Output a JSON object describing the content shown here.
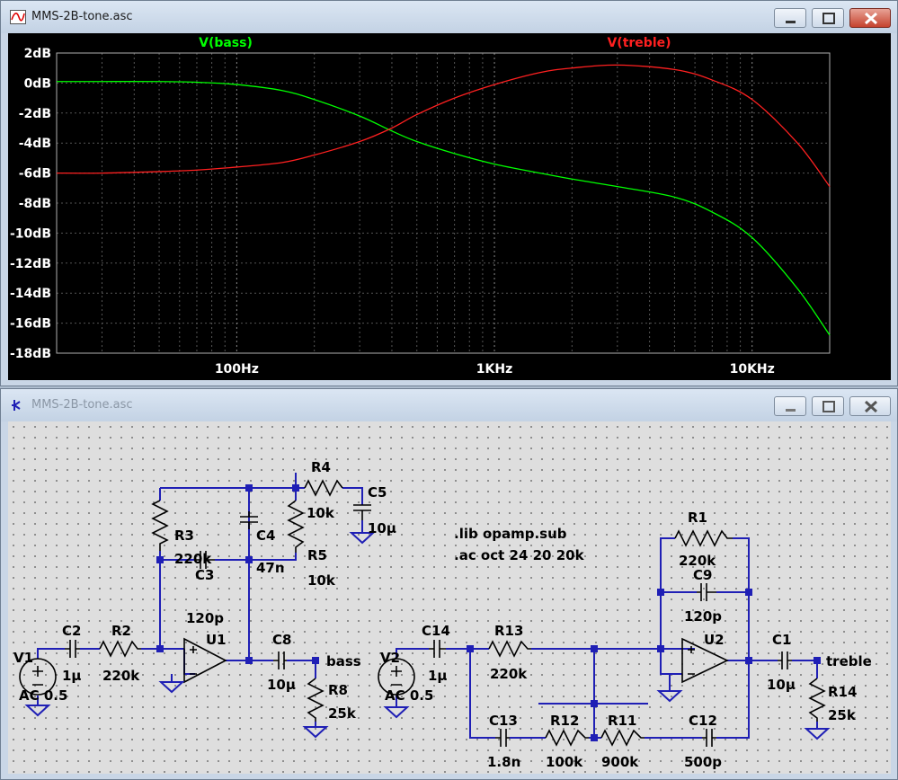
{
  "waveform_window": {
    "title": "MMS-2B-tone.asc",
    "traces": [
      {
        "name": "V(bass)",
        "color": "#00ff00"
      },
      {
        "name": "V(treble)",
        "color": "#ff2020"
      }
    ],
    "y_ticks": [
      "2dB",
      "0dB",
      "-2dB",
      "-4dB",
      "-6dB",
      "-8dB",
      "-10dB",
      "-12dB",
      "-14dB",
      "-16dB",
      "-18dB"
    ],
    "x_ticks": [
      "100Hz",
      "1KHz",
      "10KHz"
    ]
  },
  "chart_data": {
    "type": "line",
    "xscale": "log",
    "xlim": [
      20,
      20000
    ],
    "ylim": [
      -18,
      2
    ],
    "ylabel": "",
    "xlabel": "",
    "grid": true,
    "x": [
      20,
      30,
      50,
      70,
      100,
      150,
      200,
      300,
      400,
      500,
      700,
      1000,
      1500,
      2000,
      3000,
      5000,
      7000,
      10000,
      15000,
      20000
    ],
    "series": [
      {
        "name": "V(bass)",
        "values": [
          0.1,
          0.1,
          0.1,
          0.05,
          -0.1,
          -0.5,
          -1.1,
          -2.2,
          -3.2,
          -3.9,
          -4.7,
          -5.4,
          -6.0,
          -6.4,
          -6.9,
          -7.6,
          -8.6,
          -10.3,
          -13.7,
          -16.8
        ]
      },
      {
        "name": "V(treble)",
        "values": [
          -6.0,
          -6.0,
          -5.9,
          -5.8,
          -5.6,
          -5.3,
          -4.8,
          -3.9,
          -3.0,
          -2.1,
          -1.0,
          -0.1,
          0.7,
          1.0,
          1.2,
          0.9,
          0.2,
          -1.1,
          -4.0,
          -6.9
        ]
      }
    ]
  },
  "schematic_window": {
    "title": "MMS-2B-tone.asc",
    "directives": [
      ".lib opamp.sub",
      ".ac oct 24 20 20k"
    ],
    "labels": {
      "V1": "V1",
      "V1val": "AC 0.5",
      "C2": "C2",
      "C2val": "1µ",
      "R2": "R2",
      "R2val": "220k",
      "R3": "R3",
      "R3val": "220k",
      "C3": "C3",
      "C3val": "120p",
      "C4": "C4",
      "C4val": "47n",
      "R4": "R4",
      "R4val": "10k",
      "C5": "C5",
      "C5val": "10µ",
      "R5": "R5",
      "R5val": "10k",
      "U1": "U1",
      "C8": "C8",
      "C8val": "10µ",
      "bass": "bass",
      "R8": "R8",
      "R8val": "25k",
      "V2": "V2",
      "V2val": "AC 0.5",
      "C14": "C14",
      "C14val": "1µ",
      "R13": "R13",
      "R13val": "220k",
      "C13": "C13",
      "C13val": "1.8n",
      "R12": "R12",
      "R12val": "100k",
      "R11": "R11",
      "R11val": "900k",
      "C12": "C12",
      "C12val": "500p",
      "R1": "R1",
      "R1val": "220k",
      "C9": "C9",
      "C9val": "120p",
      "U2": "U2",
      "C1": "C1",
      "C1val": "10µ",
      "treble": "treble",
      "R14": "R14",
      "R14val": "25k"
    }
  },
  "colors": {
    "wire": "#1f1fb5",
    "component": "#000000",
    "text": "#000000",
    "grid": "#555555"
  }
}
